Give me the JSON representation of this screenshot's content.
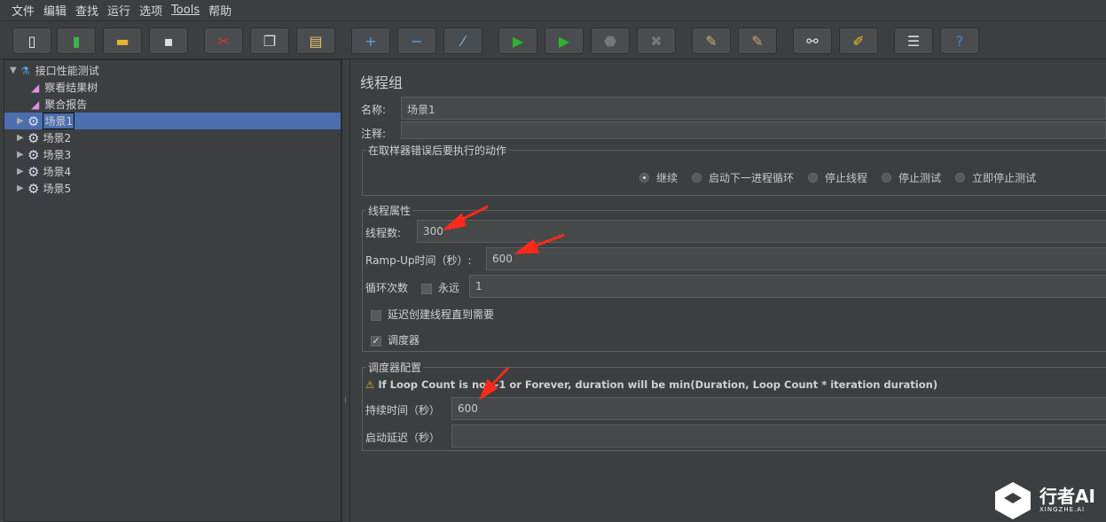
{
  "menu": [
    "文件",
    "编辑",
    "查找",
    "运行",
    "选项",
    "Tools",
    "帮助"
  ],
  "toolbar": [
    {
      "icon": "new-icon",
      "glyph": "▯",
      "color": "#eeeeee"
    },
    {
      "icon": "templates-icon",
      "glyph": "▮",
      "color": "#3bb34a"
    },
    {
      "icon": "open-icon",
      "glyph": "▬",
      "color": "#e8b430"
    },
    {
      "icon": "save-icon",
      "glyph": "▪",
      "color": "#dddddd"
    },
    {
      "icon": "cut-icon",
      "glyph": "✂",
      "color": "#e03030"
    },
    {
      "icon": "copy-icon",
      "glyph": "❐",
      "color": "#dddddd"
    },
    {
      "icon": "paste-icon",
      "glyph": "▤",
      "color": "#e8c070"
    },
    {
      "icon": "expand-icon",
      "glyph": "+",
      "color": "#5aa0e8"
    },
    {
      "icon": "collapse-icon",
      "glyph": "−",
      "color": "#5aa0e8"
    },
    {
      "icon": "toggle-icon",
      "glyph": "⁄",
      "color": "#8ab8d8"
    },
    {
      "icon": "start-icon",
      "glyph": "▶",
      "color": "#30b030"
    },
    {
      "icon": "start-no-pause-icon",
      "glyph": "▶",
      "color": "#30b030"
    },
    {
      "icon": "stop-icon",
      "glyph": "⬣",
      "color": "#777777"
    },
    {
      "icon": "shutdown-icon",
      "glyph": "✖",
      "color": "#777777"
    },
    {
      "icon": "clear-icon",
      "glyph": "✎",
      "color": "#c8b070"
    },
    {
      "icon": "clear-all-icon",
      "glyph": "✎",
      "color": "#c8a070"
    },
    {
      "icon": "search-icon",
      "glyph": "⚯",
      "color": "#dddddd"
    },
    {
      "icon": "reset-search-icon",
      "glyph": "✐",
      "color": "#f0c020"
    },
    {
      "icon": "function-helper-icon",
      "glyph": "☰",
      "color": "#dddddd"
    },
    {
      "icon": "help-icon",
      "glyph": "?",
      "color": "#4a80e0"
    }
  ],
  "tree": {
    "root": "接口性能测试",
    "listeners": [
      "察看结果树",
      "聚合报告"
    ],
    "groups": [
      "场景1",
      "场景2",
      "场景3",
      "场景4",
      "场景5"
    ]
  },
  "panel": {
    "title": "线程组",
    "name_label": "名称:",
    "name_value": "场景1",
    "comment_label": "注释:",
    "comment_value": "",
    "error_action": {
      "legend": "在取样器错误后要执行的动作",
      "options": [
        "继续",
        "启动下一进程循环",
        "停止线程",
        "停止测试",
        "立即停止测试"
      ],
      "selected": "继续"
    },
    "thread_props": {
      "legend": "线程属性",
      "threads_label": "线程数:",
      "threads_value": "300",
      "rampup_label": "Ramp-Up时间（秒）:",
      "rampup_value": "600",
      "loop_label": "循环次数",
      "forever_label": "永远",
      "forever_checked": false,
      "loop_value": "1",
      "delay_label": "延迟创建线程直到需要",
      "delay_checked": false,
      "scheduler_label": "调度器",
      "scheduler_checked": true
    },
    "scheduler": {
      "legend": "调度器配置",
      "warning": "If Loop Count is not -1 or Forever, duration will be min(Duration, Loop Count * iteration duration)",
      "duration_label": "持续时间（秒）",
      "duration_value": "600",
      "startup_label": "启动延迟（秒）",
      "startup_value": ""
    }
  },
  "watermark": {
    "brand": "行者AI",
    "sub": "XINGZHE.AI"
  },
  "colors": {
    "selection": "#4b6eaf",
    "arrow": "#ff2a1a",
    "background": "#3c3f41"
  }
}
